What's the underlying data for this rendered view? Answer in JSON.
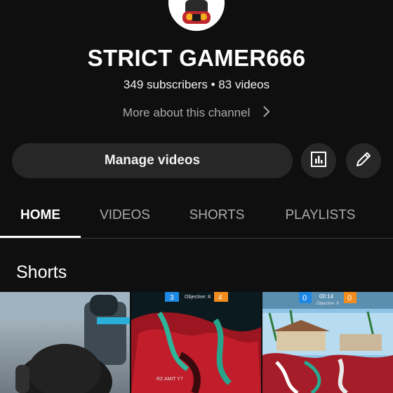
{
  "channel": {
    "name": "STRICT GAMER666",
    "stats": "349 subscribers • 83 videos",
    "more_about": "More about this channel",
    "avatar_icon": "gamer-mask-avatar"
  },
  "actions": {
    "manage_videos": "Manage videos",
    "analytics_icon": "bar-chart-icon",
    "edit_icon": "pencil-icon"
  },
  "tabs": [
    {
      "label": "HOME",
      "active": true
    },
    {
      "label": "VIDEOS",
      "active": false
    },
    {
      "label": "SHORTS",
      "active": false
    },
    {
      "label": "PLAYLISTS",
      "active": false
    }
  ],
  "sections": {
    "shorts_title": "Shorts"
  },
  "shorts": [
    {
      "hud": ""
    },
    {
      "hud_left": "3",
      "hud_center": "Objective: 8",
      "hud_right": "4",
      "hud_bottom": "RZ AMIT Y7"
    },
    {
      "hud_left": "0",
      "hud_center": "00:14",
      "hud_sub": "Objective: 8",
      "hud_right": "0"
    }
  ],
  "colors": {
    "background": "#0f0f0f",
    "button_bg": "#272727",
    "text_secondary": "#aaaaaa"
  }
}
